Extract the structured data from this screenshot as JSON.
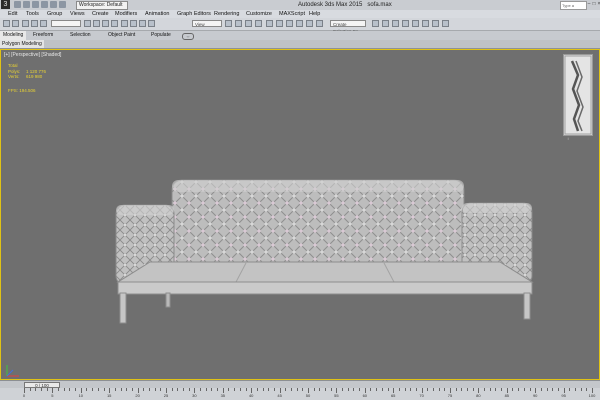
{
  "app": {
    "title": "Autodesk 3ds Max 2015",
    "file": "sofa.max",
    "workspace": "Workspace: Default",
    "search_placeholder": "Type a keyword or phrase",
    "logo_letter": "3"
  },
  "menu": [
    "Edit",
    "Tools",
    "Group",
    "Views",
    "Create",
    "Modifiers",
    "Animation",
    "Graph Editors",
    "Rendering",
    "Customize",
    "MAXScript",
    "Help"
  ],
  "toolbar": {
    "view_dropdown": "View",
    "selection_set_placeholder": "Create Selection Se"
  },
  "ribbon": {
    "tabs": [
      "Modeling",
      "Freeform",
      "Selection",
      "Object Paint",
      "Populate"
    ],
    "active_tab": "Modeling",
    "panel_label": "Polygon Modeling"
  },
  "viewport": {
    "label": "[+] [Perspective] [Shaded]",
    "stats": [
      {
        "label": "Total",
        "value": ""
      },
      {
        "label": "Polys:",
        "value": "1 120 776"
      },
      {
        "label": "Verts:",
        "value": "619 980"
      }
    ],
    "fps": "FPS:  194.506",
    "border_color": "#e0c214",
    "background": "#6f6f6f",
    "model": "tufted-sofa"
  },
  "timeline": {
    "slider_label": "0 / 100",
    "ticks": [
      "0",
      "5",
      "10",
      "15",
      "20",
      "25",
      "30",
      "35",
      "40",
      "45",
      "50",
      "55",
      "60",
      "65",
      "70",
      "75",
      "80",
      "85",
      "90",
      "95",
      "100"
    ]
  }
}
